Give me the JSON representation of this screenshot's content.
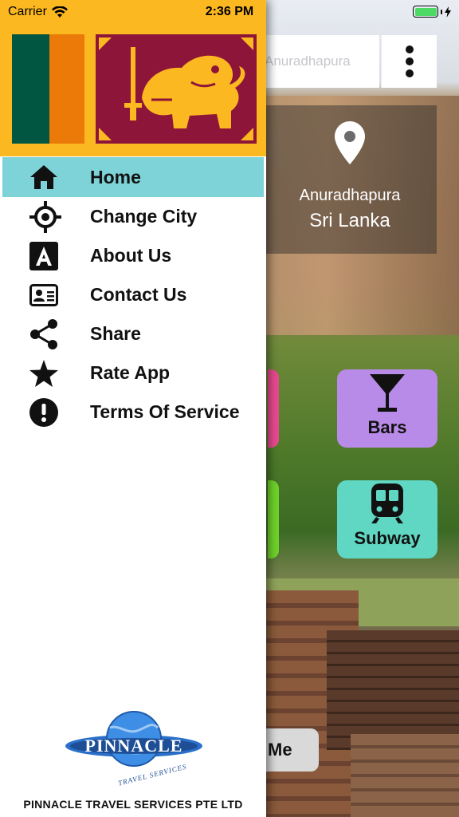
{
  "status_bar": {
    "carrier": "Carrier",
    "time": "2:36 PM"
  },
  "background": {
    "search_value": "Anuradhapura",
    "location_city": "Anuradhapura",
    "location_country": "Sri Lanka",
    "tiles": [
      {
        "label": "Bars",
        "color": "#b98be8",
        "icon": "cocktail-icon"
      },
      {
        "label": "Subway",
        "color": "#5fd7c3",
        "icon": "train-icon"
      }
    ],
    "me_button_partial": "Me"
  },
  "drawer": {
    "flag": "sri-lanka-flag",
    "menu": [
      {
        "label": "Home",
        "icon": "home-icon",
        "active": true
      },
      {
        "label": "Change City",
        "icon": "target-icon",
        "active": false
      },
      {
        "label": "About Us",
        "icon": "letter-a-icon",
        "active": false
      },
      {
        "label": "Contact Us",
        "icon": "contact-card-icon",
        "active": false
      },
      {
        "label": "Share",
        "icon": "share-icon",
        "active": false
      },
      {
        "label": "Rate App",
        "icon": "star-icon",
        "active": false
      },
      {
        "label": "Terms Of Service",
        "icon": "alert-icon",
        "active": false
      }
    ],
    "logo_text": "PINNACLE",
    "logo_subtext": "TRAVEL SERVICES",
    "company_name": "PINNACLE TRAVEL SERVICES PTE LTD"
  },
  "colors": {
    "active_item": "#7dd3d8",
    "flag_gold": "#fcb820",
    "flag_maroon": "#8d153a",
    "flag_green": "#005641",
    "flag_orange": "#ec7a08"
  }
}
